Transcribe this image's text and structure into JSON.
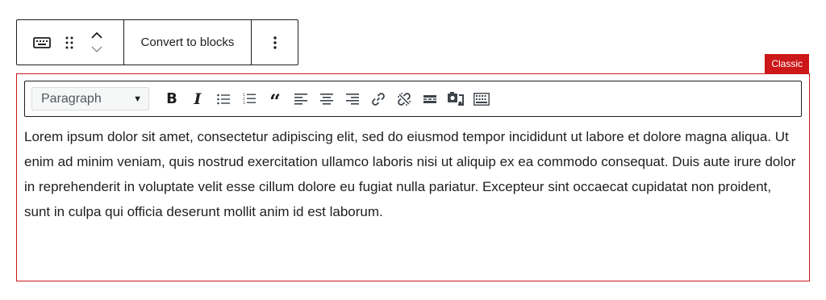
{
  "block_toolbar": {
    "convert_label": "Convert to blocks"
  },
  "classic_label": "Classic",
  "format_toolbar": {
    "format_select": "Paragraph",
    "icons": [
      "bold-icon",
      "italic-icon",
      "bullet-list-icon",
      "numbered-list-icon",
      "blockquote-icon",
      "align-left-icon",
      "align-center-icon",
      "align-right-icon",
      "link-icon",
      "unlink-icon",
      "read-more-icon",
      "insert-media-icon",
      "toolbar-toggle-icon"
    ]
  },
  "content": {
    "paragraph": "Lorem ipsum dolor sit amet, consectetur adipiscing elit, sed do eiusmod tempor incididunt ut labore et dolore magna aliqua. Ut enim ad minim veniam, quis nostrud exercitation ullamco laboris nisi ut aliquip ex ea commodo consequat. Duis aute irure dolor in reprehenderit in voluptate velit esse cillum dolore eu fugiat nulla pariatur. Excepteur sint occaecat cupidatat non proident, sunt in culpa qui officia deserunt mollit anim id est laborum."
  },
  "colors": {
    "accent_red": "#cc1818",
    "text": "#1e1e1e"
  }
}
